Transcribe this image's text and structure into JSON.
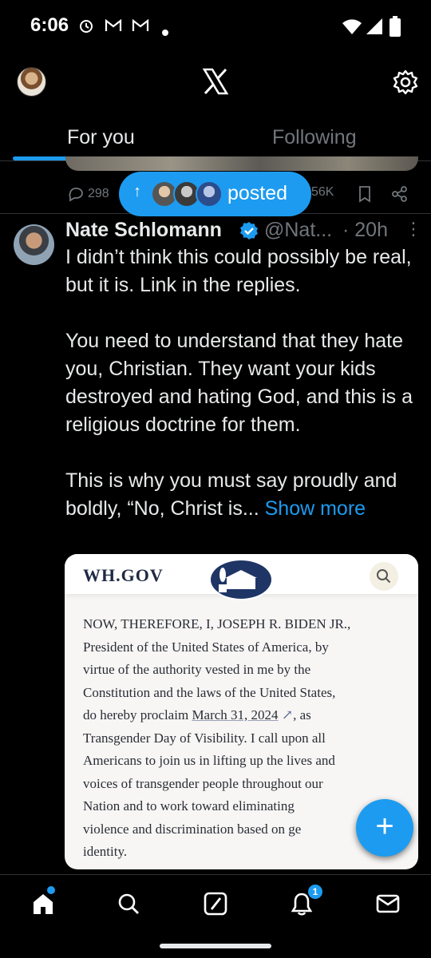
{
  "status_bar": {
    "time": "6:06",
    "left_icons": [
      "alarm-icon",
      "gmail-icon",
      "gmail-icon",
      "dot-icon"
    ],
    "right_icons": [
      "wifi-icon",
      "signal-icon",
      "battery-icon"
    ]
  },
  "header": {
    "logo": "x-logo-icon",
    "settings_icon": "gear-icon"
  },
  "tabs": [
    {
      "label": "For you",
      "active": true
    },
    {
      "label": "Following",
      "active": false
    }
  ],
  "prev_tweet": {
    "replies": "298",
    "views": "56K"
  },
  "posted_pill": {
    "label": "posted",
    "avatars": 3
  },
  "tweet": {
    "name": "Nate Schlomann",
    "handle": "@Nat...",
    "time": "· 20h",
    "more": "⋮",
    "para1": "I didn’t think this could possibly be real, but it is. Link in the replies.",
    "para2": "You need to understand that they hate you, Christian. They want your kids destroyed and hating God, and this is a religious doctrine for them.",
    "para3": "This is why you must say proudly and boldly, “No, Christ is...",
    "show_more": "Show more"
  },
  "media": {
    "site_title": "WH.GOV",
    "lines": [
      "NOW, THEREFORE, I, JOSEPH R. BIDEN JR.,",
      "President of the United States of America, by",
      "virtue of the authority vested in me by the",
      "Constitution and the laws of the United States,",
      "do hereby proclaim ",
      "Transgender Day of Visibility.  I call upon all",
      "Americans to join us in lifting up the lives and",
      "voices of transgender people throughout our",
      "Nation and to work toward eliminating",
      "violence and discrimination based on ge",
      "identity."
    ],
    "link_date": "March 31, 2024",
    "link_suffix": ", as"
  },
  "fab": {
    "label": "+"
  },
  "bottom_nav": {
    "items": [
      "home-icon",
      "search-icon",
      "grok-icon",
      "notifications-icon",
      "messages-icon"
    ],
    "notification_count": "1"
  },
  "colors": {
    "accent": "#1d9bf0",
    "background": "#000000",
    "text": "#e7e9ea",
    "muted": "#71767b"
  }
}
